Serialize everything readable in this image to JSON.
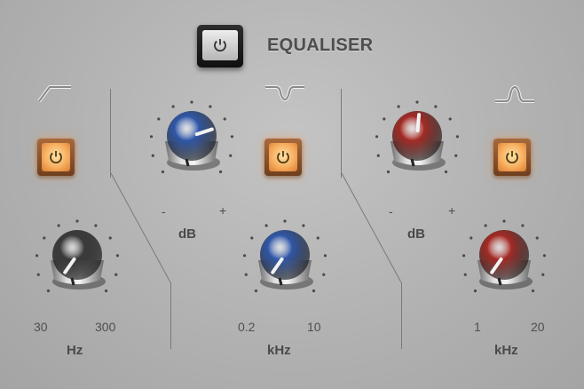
{
  "header": {
    "title": "EQUALISER"
  },
  "sections": {
    "low": {
      "freq_unit": "Hz",
      "freq_min": "30",
      "freq_max": "300"
    },
    "mid": {
      "gain_unit": "dB",
      "gain_minus": "-",
      "gain_plus": "+",
      "freq_unit": "kHz",
      "freq_min": "0.2",
      "freq_max": "10"
    },
    "high": {
      "gain_unit": "dB",
      "gain_minus": "-",
      "gain_plus": "+",
      "freq_unit": "kHz",
      "freq_min": "1",
      "freq_max": "20"
    }
  },
  "colors": {
    "blue_cap": "#2f57a8",
    "red_cap": "#a42a24",
    "dark_cap": "#3a3a3a",
    "led": "#f7ae5f"
  },
  "icons": {
    "power": "power-icon",
    "low_filter": "low-shelf-icon",
    "mid_filter": "notch-icon",
    "high_filter": "bell-icon"
  }
}
